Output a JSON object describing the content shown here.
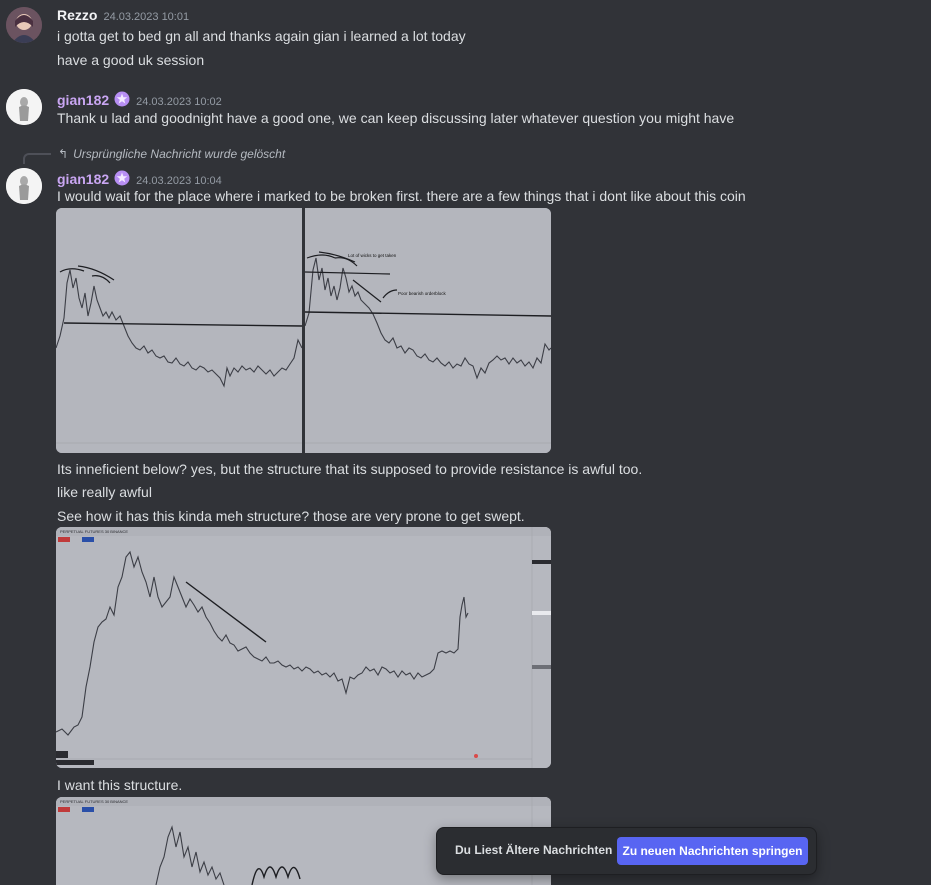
{
  "messages": {
    "rezzo": {
      "author": "Rezzo",
      "timestamp": "24.03.2023 10:01",
      "lines": [
        "i gotta get to bed gn all and thanks again gian i learned a lot today",
        "have a good uk session"
      ]
    },
    "gian1": {
      "author": "gian182",
      "timestamp": "24.03.2023 10:02",
      "lines": [
        "Thank u lad and goodnight have a good one, we can keep discussing later whatever question you might have"
      ]
    },
    "gian2": {
      "reply_text": "Ursprüngliche Nachricht wurde gelöscht",
      "author": "gian182",
      "timestamp": "24.03.2023 10:04",
      "line1": "I would wait for the place where i marked to be broken first. there are a few things that i dont like about this coin",
      "chart_annotations": [
        "Lot of wicks to get taken",
        "Poor bearish orderblock"
      ],
      "after_images": [
        "Its inneficient below? yes, but the structure that its supposed to provide resistance is awful too.",
        "like really awful",
        "See how it has this kinda meh structure? those are very prone to get swept."
      ],
      "chart_header": "PERPETUAL FUTURES  30  BINANCE",
      "after_chart": "I want this structure."
    }
  },
  "jump_bar": {
    "older_label": "Du Liest Ältere Nachrichten",
    "jump_button_label": "Zu neuen Nachrichten springen"
  },
  "icons": {
    "reply": "reply-arrow-icon",
    "badge": "nitro-badge-icon"
  },
  "colors": {
    "background": "#313338",
    "username_purple": "#c9a6f2",
    "accent_blurple": "#5865f2",
    "chart_background": "#b6b8bf"
  }
}
